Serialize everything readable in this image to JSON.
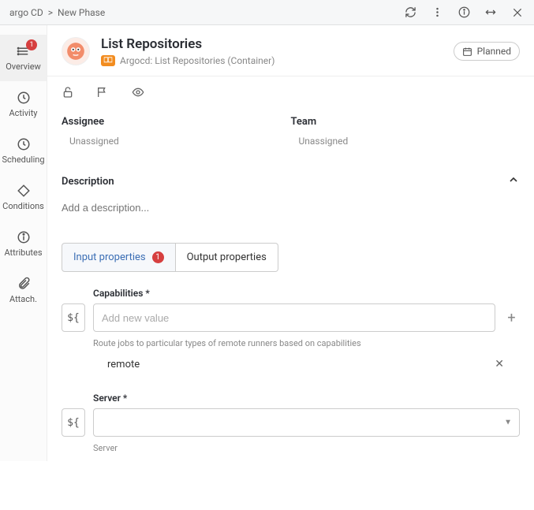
{
  "topbar": {
    "breadcrumb": [
      "argo CD",
      "New Phase"
    ],
    "sep": ">"
  },
  "sidenav": {
    "items": [
      {
        "label": "Overview",
        "badge": "1"
      },
      {
        "label": "Activity"
      },
      {
        "label": "Scheduling"
      },
      {
        "label": "Conditions"
      },
      {
        "label": "Attributes"
      },
      {
        "label": "Attach."
      }
    ]
  },
  "header": {
    "title": "List Repositories",
    "subtitle": "Argocd: List Repositories (Container)",
    "status": "Planned"
  },
  "fields": {
    "assignee": {
      "label": "Assignee",
      "value": "Unassigned"
    },
    "team": {
      "label": "Team",
      "value": "Unassigned"
    }
  },
  "description": {
    "label": "Description",
    "placeholder": "Add a description..."
  },
  "tabs": {
    "input": {
      "label": "Input properties",
      "badge": "1"
    },
    "output": {
      "label": "Output properties"
    }
  },
  "props": {
    "capabilities": {
      "label": "Capabilities *",
      "placeholder": "Add new value",
      "help": "Route jobs to particular types of remote runners based on capabilities",
      "chip": "remote"
    },
    "server": {
      "label": "Server *",
      "help": "Server"
    },
    "varBtn": "${"
  }
}
